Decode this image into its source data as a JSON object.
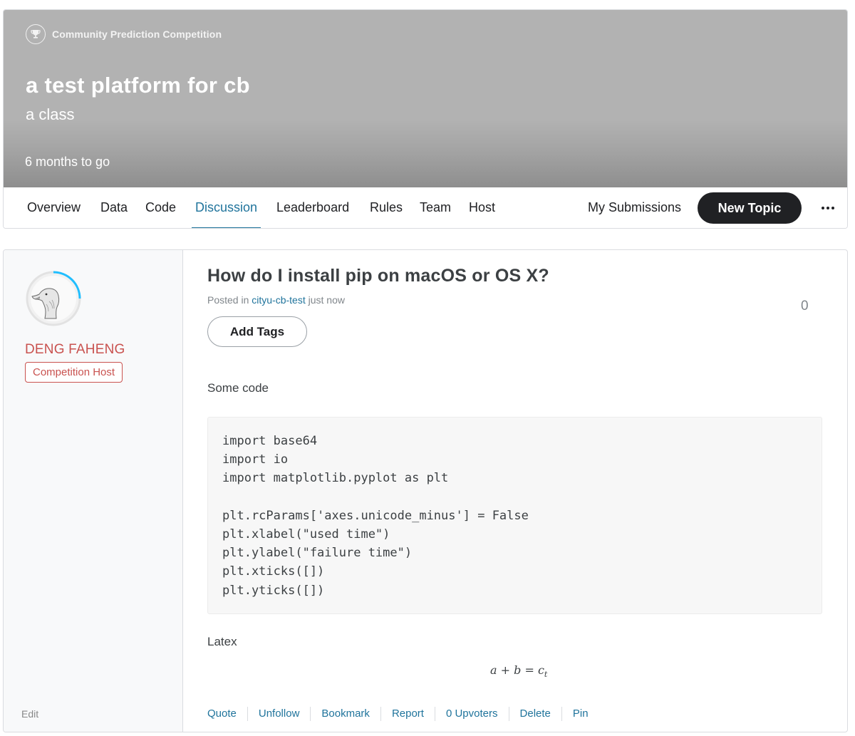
{
  "competition": {
    "host_type": "Community Prediction Competition",
    "title": "a test platform for cb",
    "subtitle": "a class",
    "deadline": "6 months to go",
    "banner_color": "#b2b2b2"
  },
  "nav": {
    "tabs": [
      {
        "label": "Overview",
        "active": false
      },
      {
        "label": "Data",
        "active": false
      },
      {
        "label": "Code",
        "active": false
      },
      {
        "label": "Discussion",
        "active": true
      },
      {
        "label": "Leaderboard",
        "active": false
      },
      {
        "label": "Rules",
        "active": false
      },
      {
        "label": "Team",
        "active": false
      },
      {
        "label": "Host",
        "active": false
      }
    ],
    "my_submissions": "My Submissions",
    "new_topic": "New Topic",
    "more_icon": "more-horizontal-icon",
    "accent_color": "#20749c"
  },
  "author": {
    "name": "DENG FAHENG",
    "role": "Competition Host",
    "avatar_icon": "goose-avatar",
    "tier_color": "#20beff",
    "role_color": "#c9524f",
    "edit_label": "Edit"
  },
  "topic": {
    "title": "How do I install pip on macOS or OS X?",
    "posted_prefix": "Posted in",
    "forum": "cityu-cb-test",
    "posted_time": "just now",
    "votes": "0",
    "add_tags": "Add Tags",
    "intro": "Some code",
    "code_lines": [
      "import base64",
      "import io",
      "import matplotlib.pyplot as plt",
      "",
      "plt.rcParams['axes.unicode_minus'] = False",
      "plt.xlabel(\"used time\")",
      "plt.ylabel(\"failure time\")",
      "plt.xticks([])",
      "plt.yticks([])"
    ],
    "latex_label": "Latex",
    "latex_formula": {
      "main": "a + b = c",
      "subscript": "t"
    },
    "actions": [
      "Quote",
      "Unfollow",
      "Bookmark",
      "Report",
      "0 Upvoters",
      "Delete",
      "Pin"
    ]
  }
}
